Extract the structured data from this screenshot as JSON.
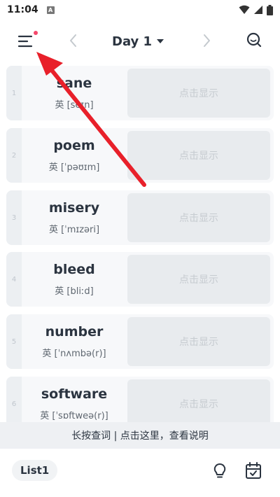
{
  "status_bar": {
    "time": "11:04",
    "notif_letter": "A"
  },
  "header": {
    "day_label": "Day 1"
  },
  "words": [
    {
      "index": "1",
      "word": "sane",
      "phonetic": "英 [seɪn]",
      "reveal": "点击显示"
    },
    {
      "index": "2",
      "word": "poem",
      "phonetic": "英 [ˈpəʊɪm]",
      "reveal": "点击显示"
    },
    {
      "index": "3",
      "word": "misery",
      "phonetic": "英 [ˈmɪzəri]",
      "reveal": "点击显示"
    },
    {
      "index": "4",
      "word": "bleed",
      "phonetic": "英 [bliːd]",
      "reveal": "点击显示"
    },
    {
      "index": "5",
      "word": "number",
      "phonetic": "英 [ˈnʌmbə(r)]",
      "reveal": "点击显示"
    },
    {
      "index": "6",
      "word": "software",
      "phonetic": "英 [ˈsɒftweə(r)]",
      "reveal": "点击显示"
    }
  ],
  "hint": {
    "text": "长按查词 | 点击这里，查看说明"
  },
  "bottom": {
    "list_label": "List1"
  },
  "colors": {
    "accent_dot": "#f4476b",
    "annotation_arrow": "#e8202a",
    "card_bg": "#f7f8fa",
    "reveal_bg": "#e8ebee"
  },
  "icons": [
    "menu-icon",
    "chevron-left-icon",
    "chevron-right-icon",
    "caret-down-icon",
    "search-icon",
    "lightbulb-icon",
    "calendar-check-icon",
    "wifi-icon",
    "signal-icon",
    "battery-icon"
  ]
}
